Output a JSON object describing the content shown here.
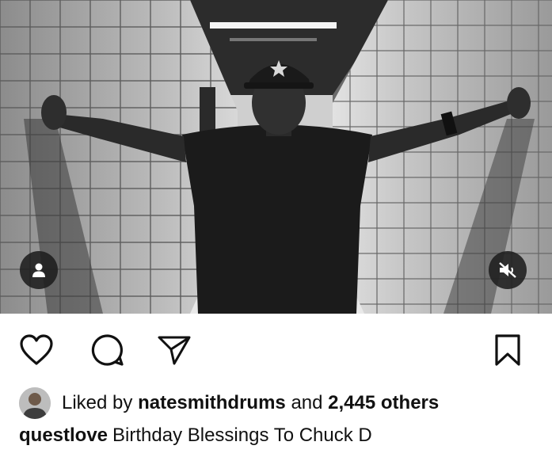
{
  "post": {
    "media": {
      "description_icon": "person-tag-icon",
      "mute_icon": "speaker-muted-icon"
    },
    "actions": {
      "like_icon": "heart-icon",
      "comment_icon": "comment-bubble-icon",
      "share_icon": "paper-plane-icon",
      "save_icon": "bookmark-icon"
    },
    "likes": {
      "prefix": "Liked by",
      "username": "natesmithdrums",
      "connector": "and",
      "others": "2,445 others"
    },
    "caption": {
      "username": "questlove",
      "text": "Birthday Blessings To Chuck D"
    }
  },
  "colors": {
    "text": "#111111",
    "overlay_button": "#1e1e1e",
    "background": "#ffffff"
  }
}
